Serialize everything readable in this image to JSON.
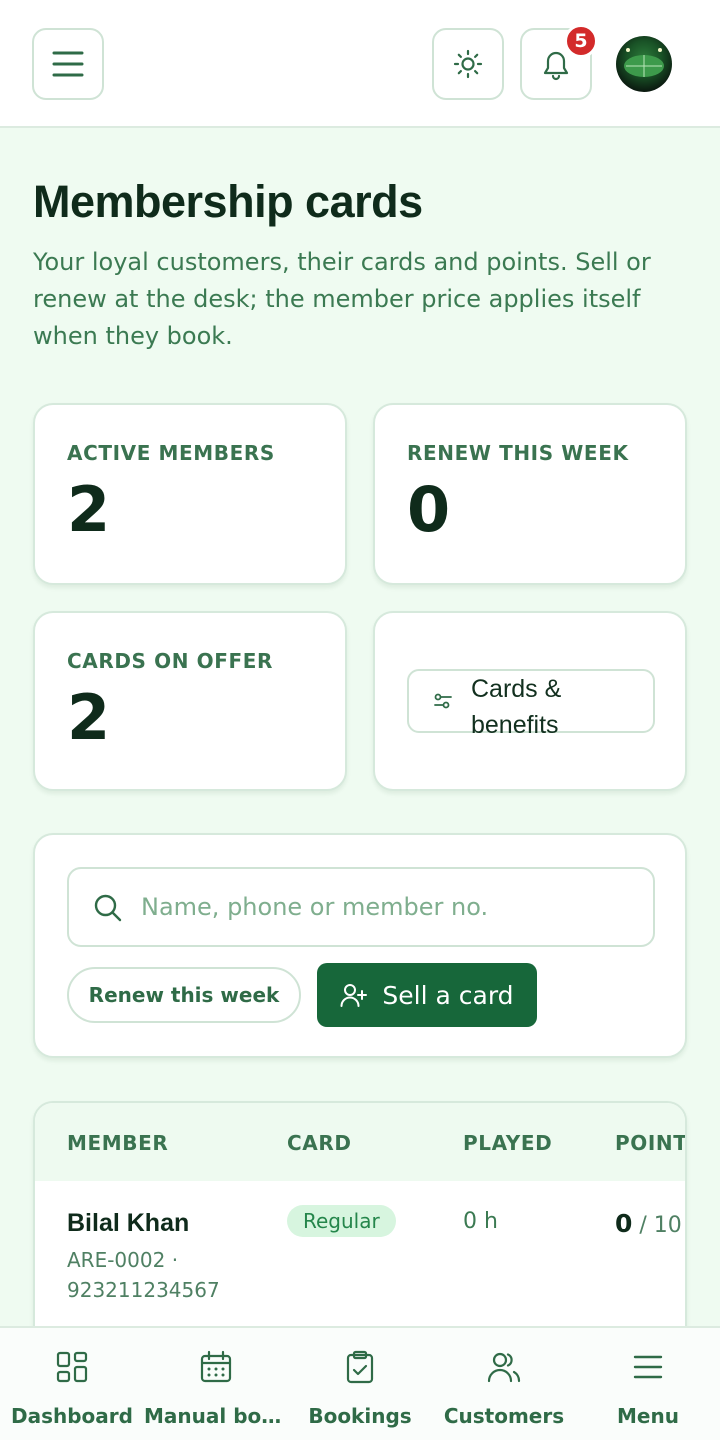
{
  "header": {
    "menu_icon": "hamburger-menu-icon",
    "theme_icon": "sun-icon",
    "bell_icon": "bell-icon",
    "notification_count": "5",
    "avatar": "stadium-photo-avatar"
  },
  "page": {
    "title": "Membership cards",
    "description": "Your loyal customers, their cards and points. Sell or renew at the desk; the member price applies itself when they book."
  },
  "stats": {
    "active_members_label": "ACTIVE MEMBERS",
    "active_members_value": "2",
    "renew_week_label": "RENEW THIS WEEK",
    "renew_week_value": "0",
    "cards_offer_label": "CARDS ON OFFER",
    "cards_offer_value": "2",
    "cards_benefits_button": "Cards & benefits"
  },
  "search": {
    "placeholder": "Name, phone or member no.",
    "renew_button": "Renew this week",
    "sell_button": "Sell a card"
  },
  "table": {
    "headers": [
      "MEMBER",
      "CARD",
      "PLAYED",
      "POINTS"
    ],
    "rows": [
      {
        "name": "Bilal Khan",
        "meta": "ARE-0002 · 923211234567",
        "card": "Regular",
        "played": "0 h",
        "points": "0",
        "points_total": "/ 10"
      }
    ]
  },
  "bottom_nav": {
    "items": [
      {
        "label": "Dashboard",
        "icon": "grid-icon"
      },
      {
        "label": "Manual boo…",
        "icon": "calendar-icon"
      },
      {
        "label": "Bookings",
        "icon": "clipboard-check-icon"
      },
      {
        "label": "Customers",
        "icon": "users-icon"
      },
      {
        "label": "Menu",
        "icon": "hamburger-menu-icon"
      }
    ]
  },
  "colors": {
    "accent": "#17673a",
    "background": "#effbf1",
    "badge": "#d32a2a"
  }
}
